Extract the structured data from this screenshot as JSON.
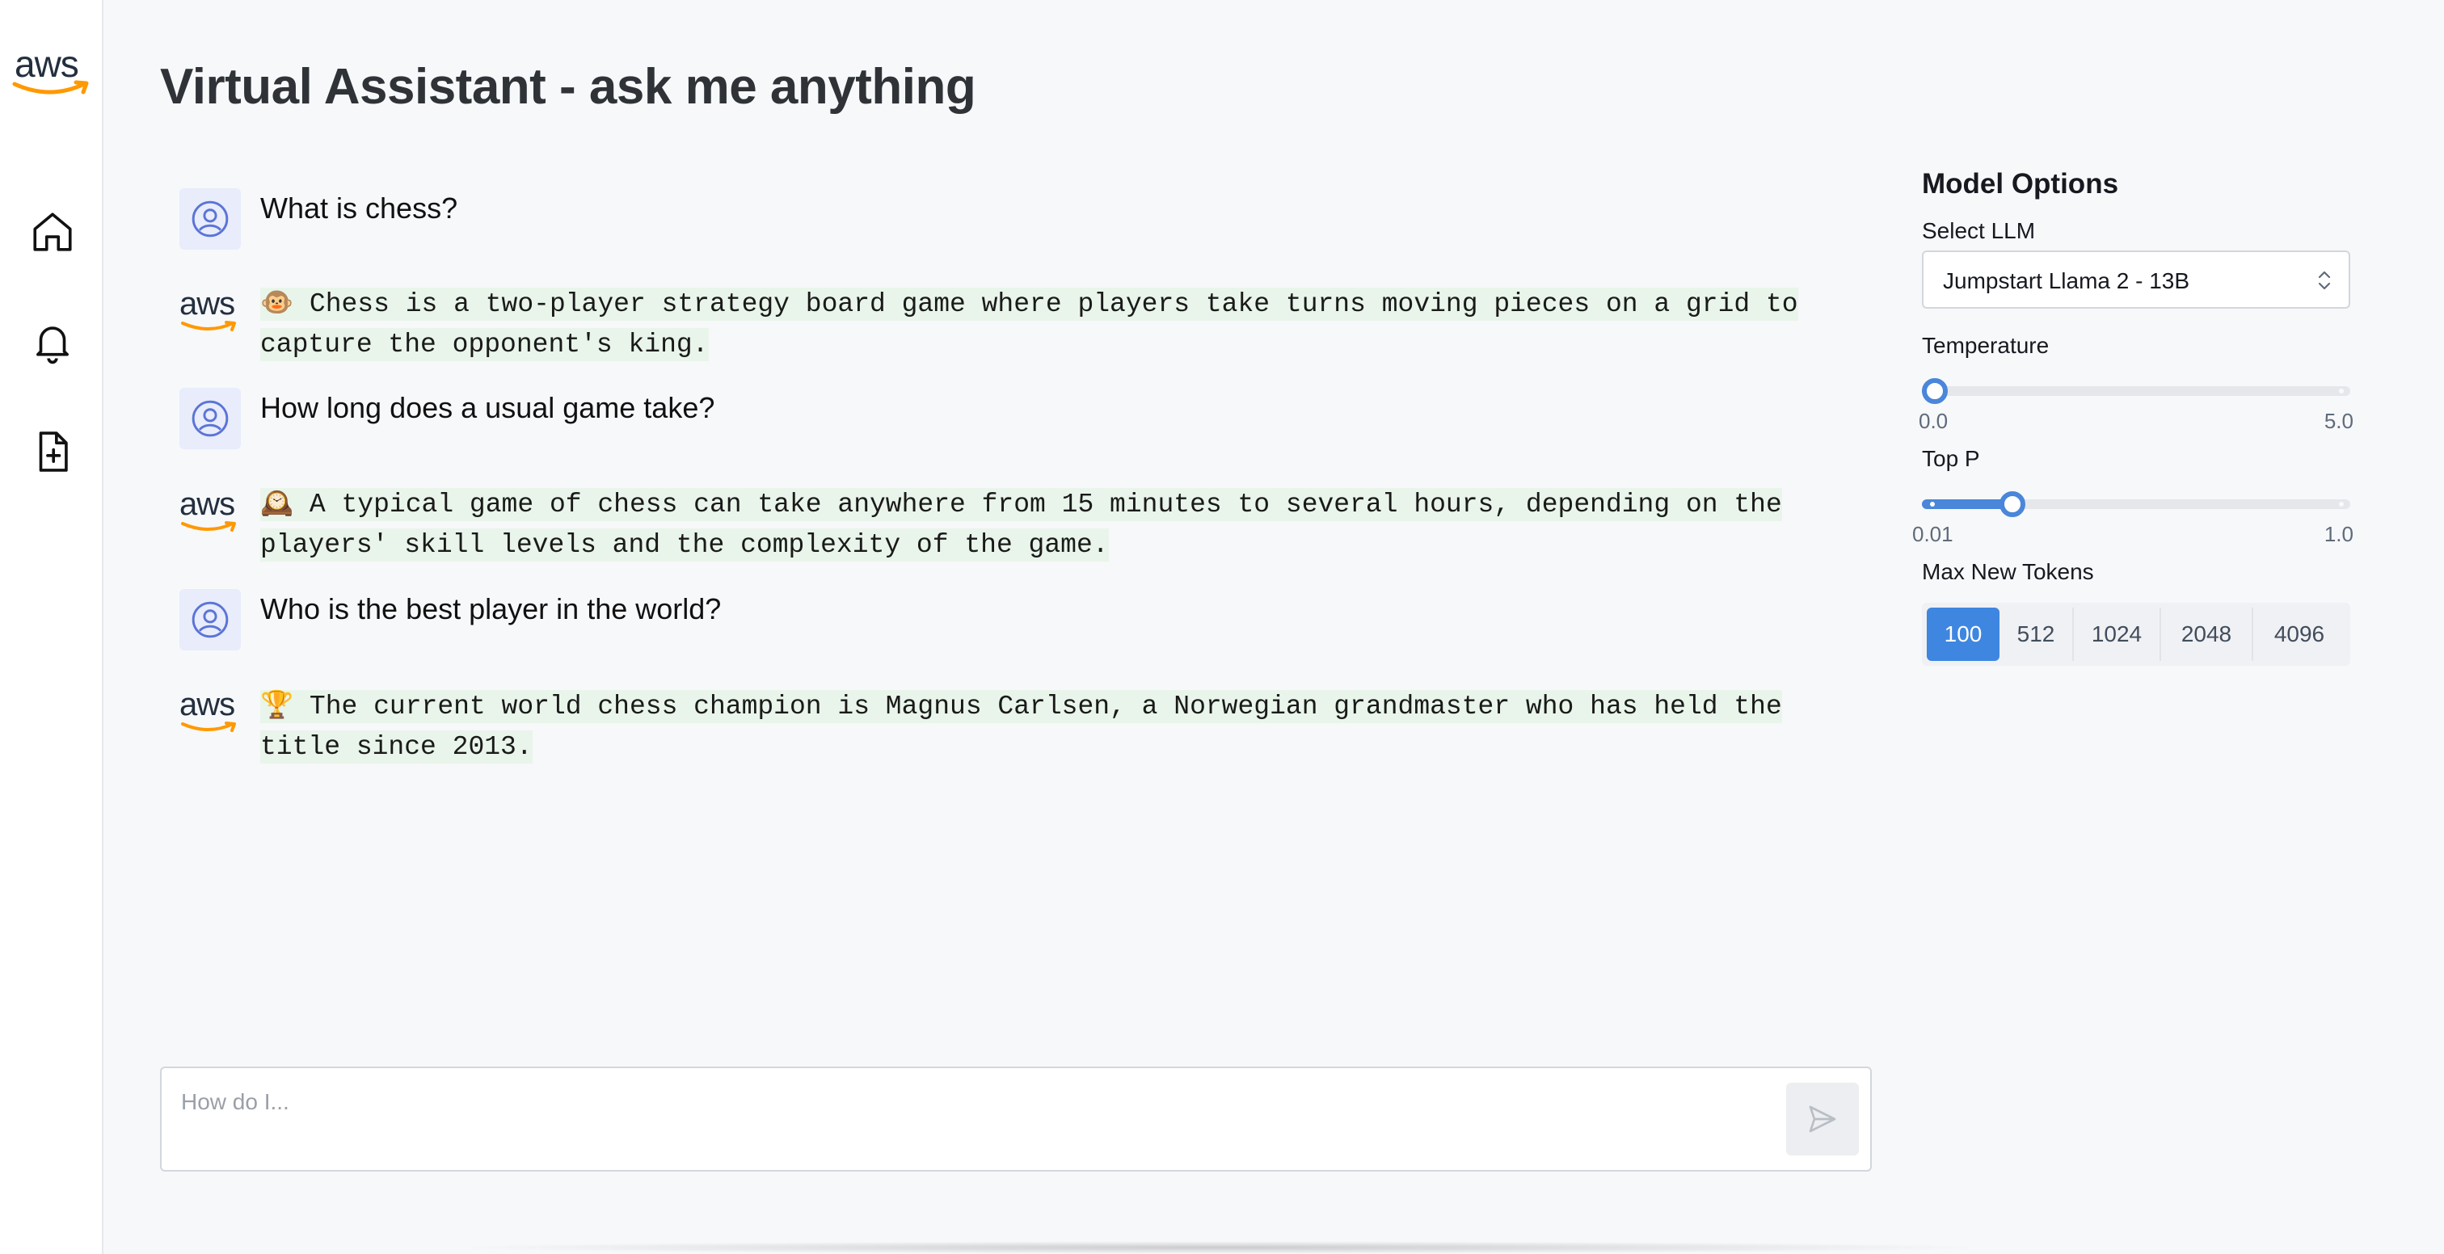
{
  "sidebar": {
    "logo_text": "aws",
    "items": [
      {
        "name": "home",
        "icon": "home-icon"
      },
      {
        "name": "notifications",
        "icon": "bell-icon"
      },
      {
        "name": "new-document",
        "icon": "file-plus-icon"
      }
    ]
  },
  "page": {
    "title": "Virtual Assistant - ask me anything"
  },
  "chat": {
    "messages": [
      {
        "role": "user",
        "text": "What is chess?"
      },
      {
        "role": "assistant",
        "text": "🐵 Chess is a two-player strategy board game where players take turns moving pieces on a grid to capture the opponent's king."
      },
      {
        "role": "user",
        "text": "How long does a usual game take?"
      },
      {
        "role": "assistant",
        "text": "🕰️ A typical game of chess can take anywhere from 15 minutes to several hours, depending on the players' skill levels and the complexity of the game."
      },
      {
        "role": "user",
        "text": "Who is the best player in the world?"
      },
      {
        "role": "assistant",
        "text": "🏆 The current world chess champion is Magnus Carlsen, a Norwegian grandmaster who has held the title since 2013."
      }
    ],
    "input_placeholder": "How do I..."
  },
  "options": {
    "title": "Model Options",
    "select_llm_label": "Select LLM",
    "select_llm_value": "Jumpstart Llama 2 - 13B",
    "temperature": {
      "label": "Temperature",
      "min_label": "0.0",
      "max_label": "5.0",
      "min": 0.0,
      "max": 5.0,
      "value": 0.1
    },
    "top_p": {
      "label": "Top P",
      "min_label": "0.01",
      "max_label": "1.0",
      "min": 0.01,
      "max": 1.0,
      "value": 0.22
    },
    "max_tokens": {
      "label": "Max New Tokens",
      "options": [
        "100",
        "512",
        "1024",
        "2048",
        "4096"
      ],
      "selected": "100"
    }
  },
  "colors": {
    "accent": "#3e86e0",
    "aws_orange": "#ff9900",
    "answer_highlight": "#e9f5ea"
  }
}
